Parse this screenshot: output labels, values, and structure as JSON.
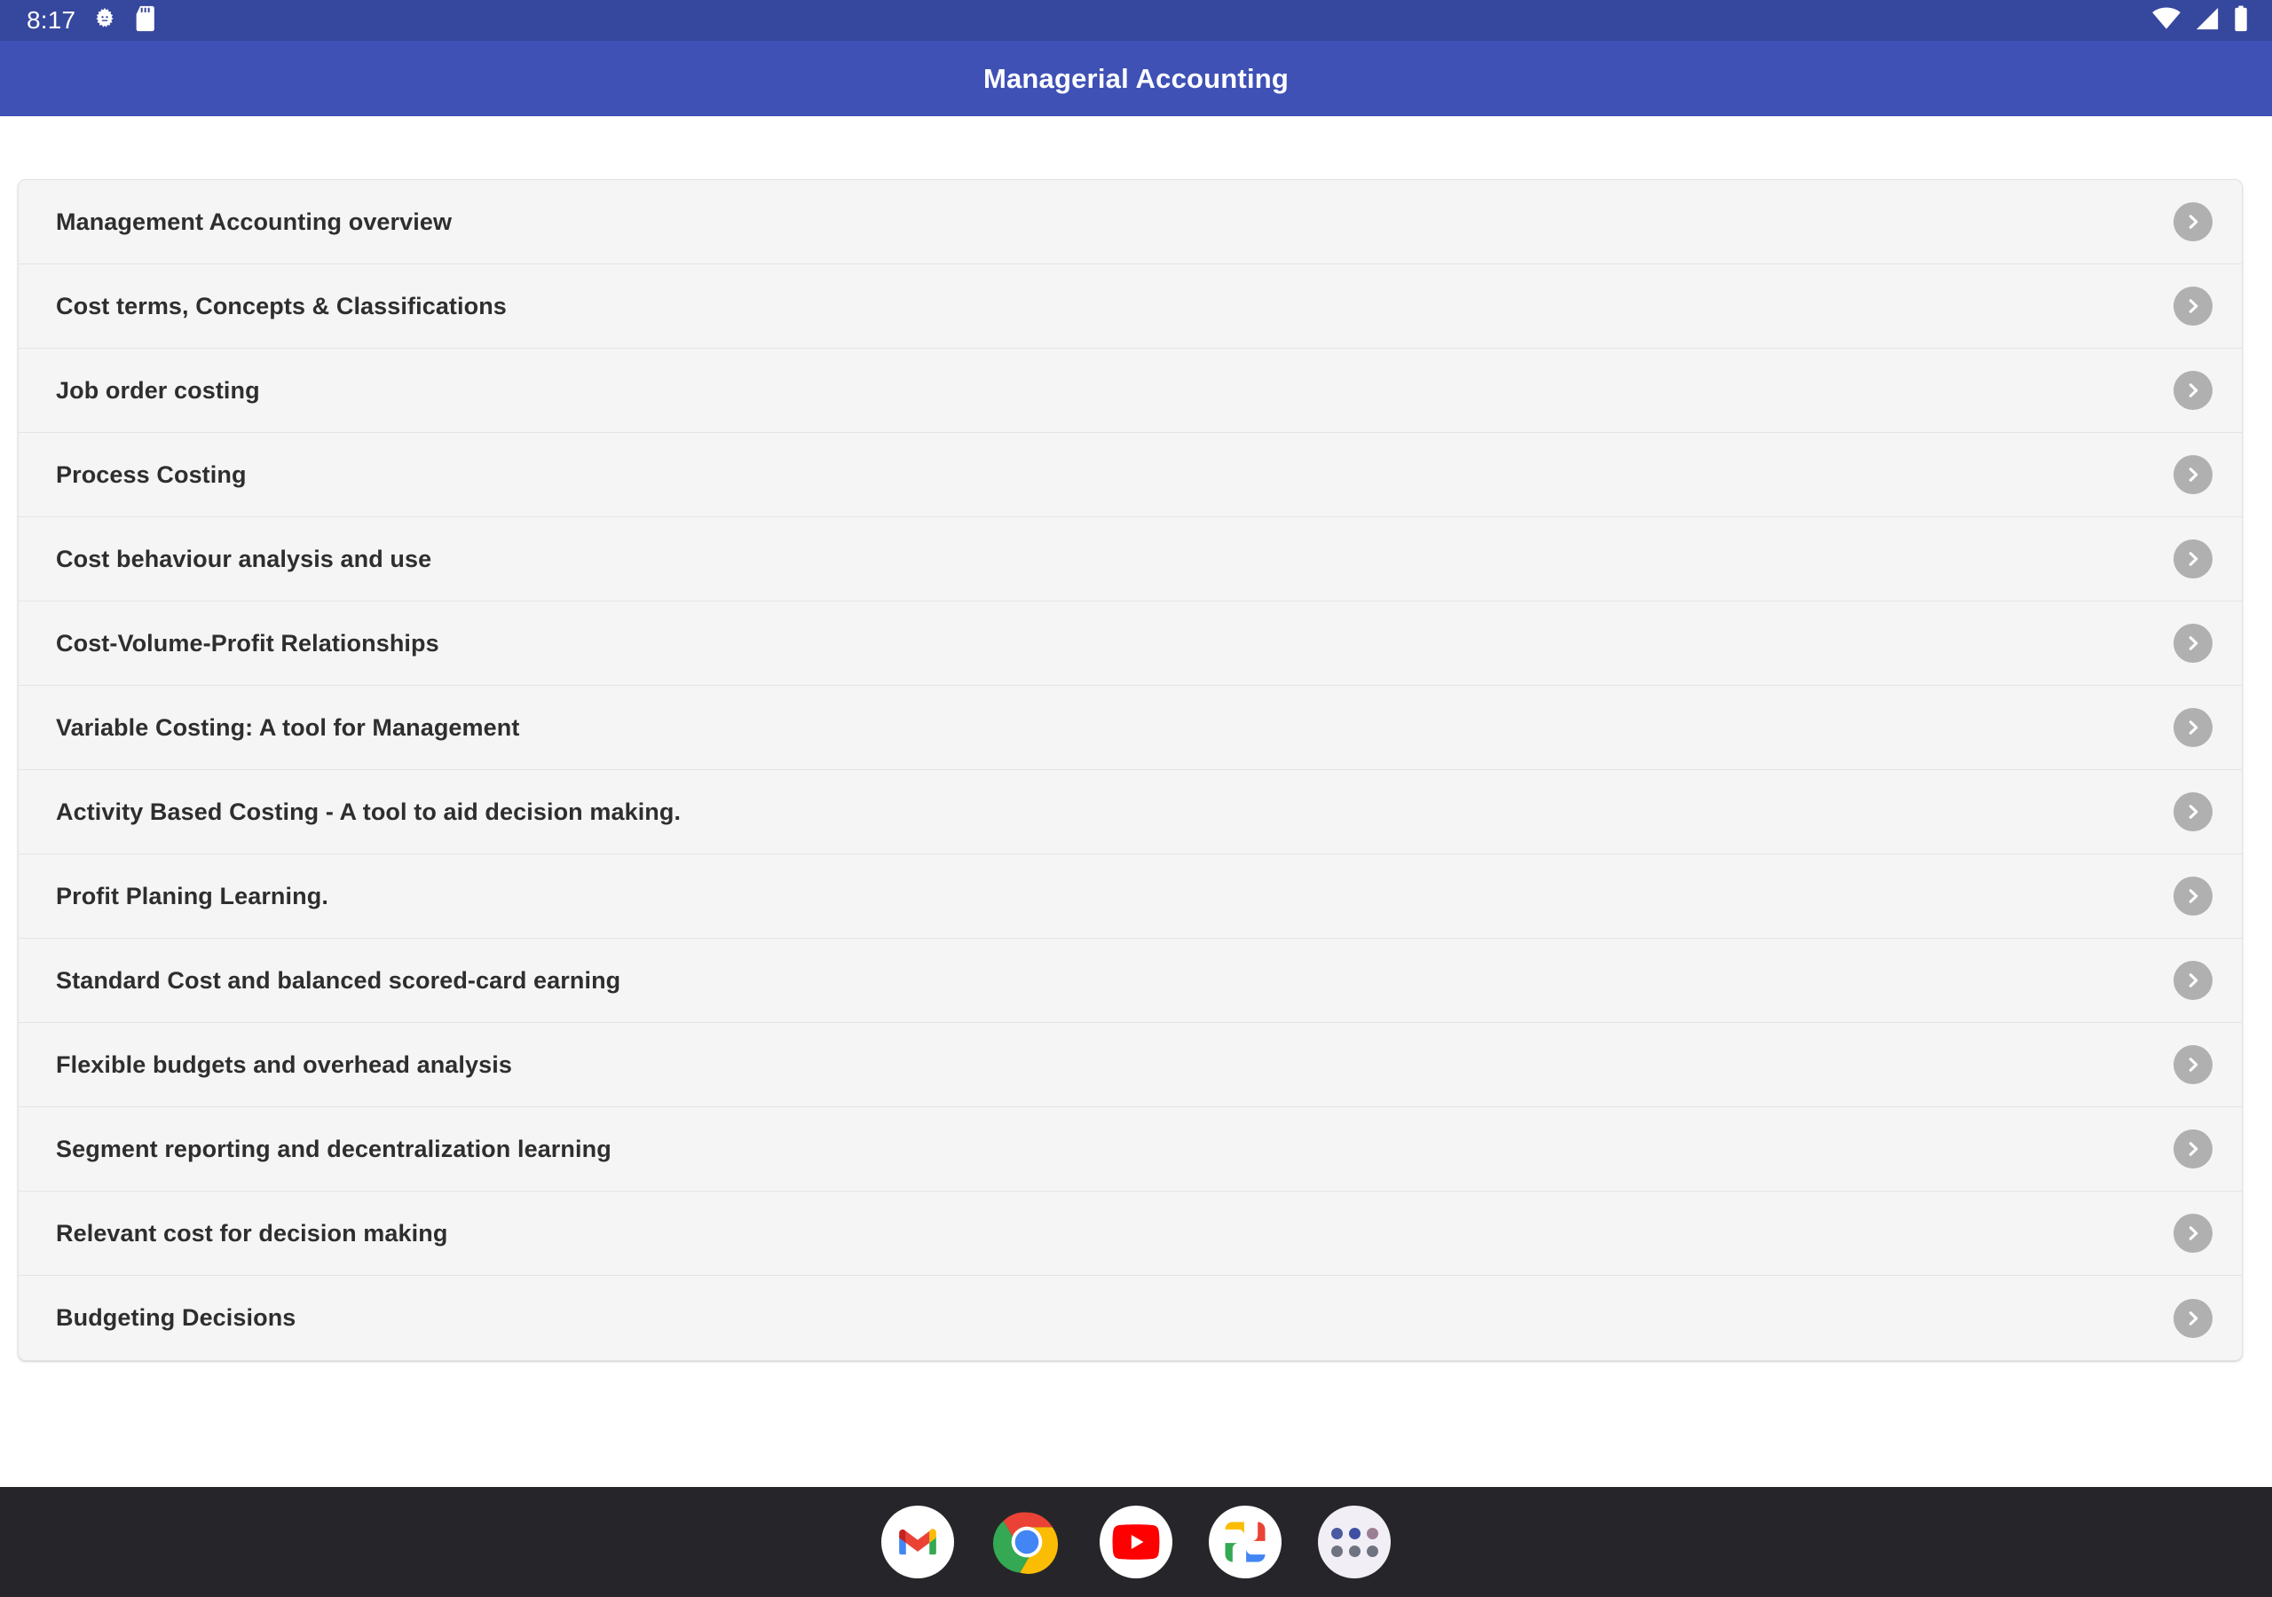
{
  "status_bar": {
    "time": "8:17",
    "left_icons": [
      "android-settings-icon",
      "sd-card-icon"
    ],
    "right_icons": [
      "wifi-icon",
      "cellular-signal-icon",
      "battery-icon"
    ],
    "background_color": "#36479e",
    "foreground_color": "#ffffff"
  },
  "app_bar": {
    "title": "Managerial Accounting",
    "background_color": "#3f51b5",
    "title_color": "#ffffff"
  },
  "topic_list": {
    "background_color": "#f5f5f5",
    "chevron_color": "#b0b0b0",
    "items": [
      {
        "label": "Management Accounting overview",
        "chevron": "chevron-right-icon"
      },
      {
        "label": "Cost terms, Concepts & Classifications",
        "chevron": "chevron-right-icon"
      },
      {
        "label": "Job order costing",
        "chevron": "chevron-right-icon"
      },
      {
        "label": "Process Costing",
        "chevron": "chevron-right-icon"
      },
      {
        "label": "Cost behaviour analysis and use",
        "chevron": "chevron-right-icon"
      },
      {
        "label": "Cost-Volume-Profit Relationships",
        "chevron": "chevron-right-icon"
      },
      {
        "label": "Variable Costing: A tool for Management",
        "chevron": "chevron-right-icon"
      },
      {
        "label": "Activity Based Costing - A tool to aid decision making.",
        "chevron": "chevron-right-icon"
      },
      {
        "label": "Profit Planing Learning.",
        "chevron": "chevron-right-icon"
      },
      {
        "label": "Standard Cost and balanced scored-card earning",
        "chevron": "chevron-right-icon"
      },
      {
        "label": "Flexible budgets and overhead analysis",
        "chevron": "chevron-right-icon"
      },
      {
        "label": "Segment reporting and decentralization learning",
        "chevron": "chevron-right-icon"
      },
      {
        "label": "Relevant cost for decision making",
        "chevron": "chevron-right-icon"
      },
      {
        "label": "Budgeting Decisions",
        "chevron": "chevron-right-icon"
      }
    ]
  },
  "dock": {
    "background_color": "#26262a",
    "items": [
      {
        "name": "gmail-icon"
      },
      {
        "name": "chrome-icon"
      },
      {
        "name": "youtube-icon"
      },
      {
        "name": "google-photos-icon"
      },
      {
        "name": "app-drawer-icon"
      }
    ]
  }
}
